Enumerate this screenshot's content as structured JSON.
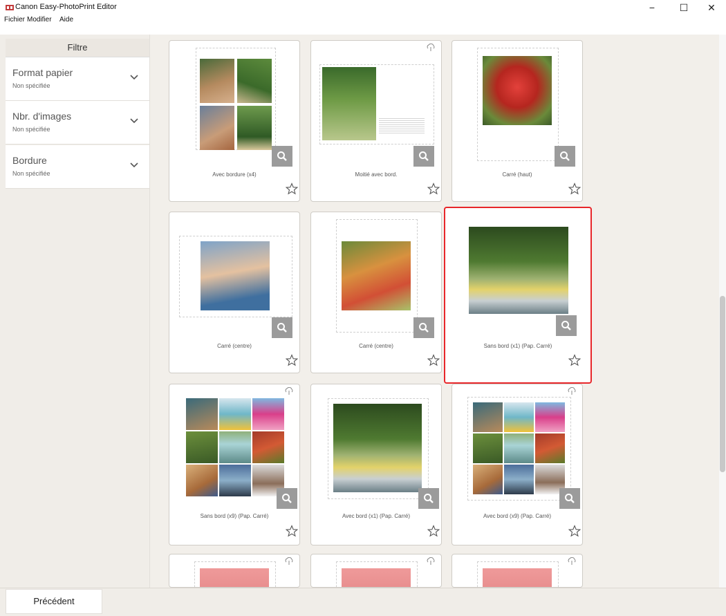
{
  "window": {
    "title": "Canon Easy-PhotoPrint Editor",
    "controls": {
      "minimize": "−",
      "maximize": "☐",
      "close": "✕"
    }
  },
  "menu": [
    "Fichier",
    "Modifier",
    "Aide"
  ],
  "sidebar": {
    "header": "Filtre",
    "filters": [
      {
        "label": "Format papier",
        "value": "Non spécifiée"
      },
      {
        "label": "Nbr. d'images",
        "value": "Non spécifiée"
      },
      {
        "label": "Bordure",
        "value": "Non spécifiée"
      }
    ]
  },
  "templates": [
    {
      "label": "Avec bordure (x4)"
    },
    {
      "label": "Moitié avec bord."
    },
    {
      "label": "Carré (haut)"
    },
    {
      "label": "Carré (centre)"
    },
    {
      "label": "Carré (centre)"
    },
    {
      "label": "Sans bord (x1) (Pap. Carré)"
    },
    {
      "label": "Sans bord (x9) (Pap. Carré)"
    },
    {
      "label": "Avec bord (x1) (Pap. Carré)"
    },
    {
      "label": "Avec bord (x9) (Pap. Carré)"
    }
  ],
  "footer": {
    "previous_label": "Précédent"
  },
  "colors": {
    "selection": "#e8262a",
    "accent_gray": "#9b9b9b"
  }
}
